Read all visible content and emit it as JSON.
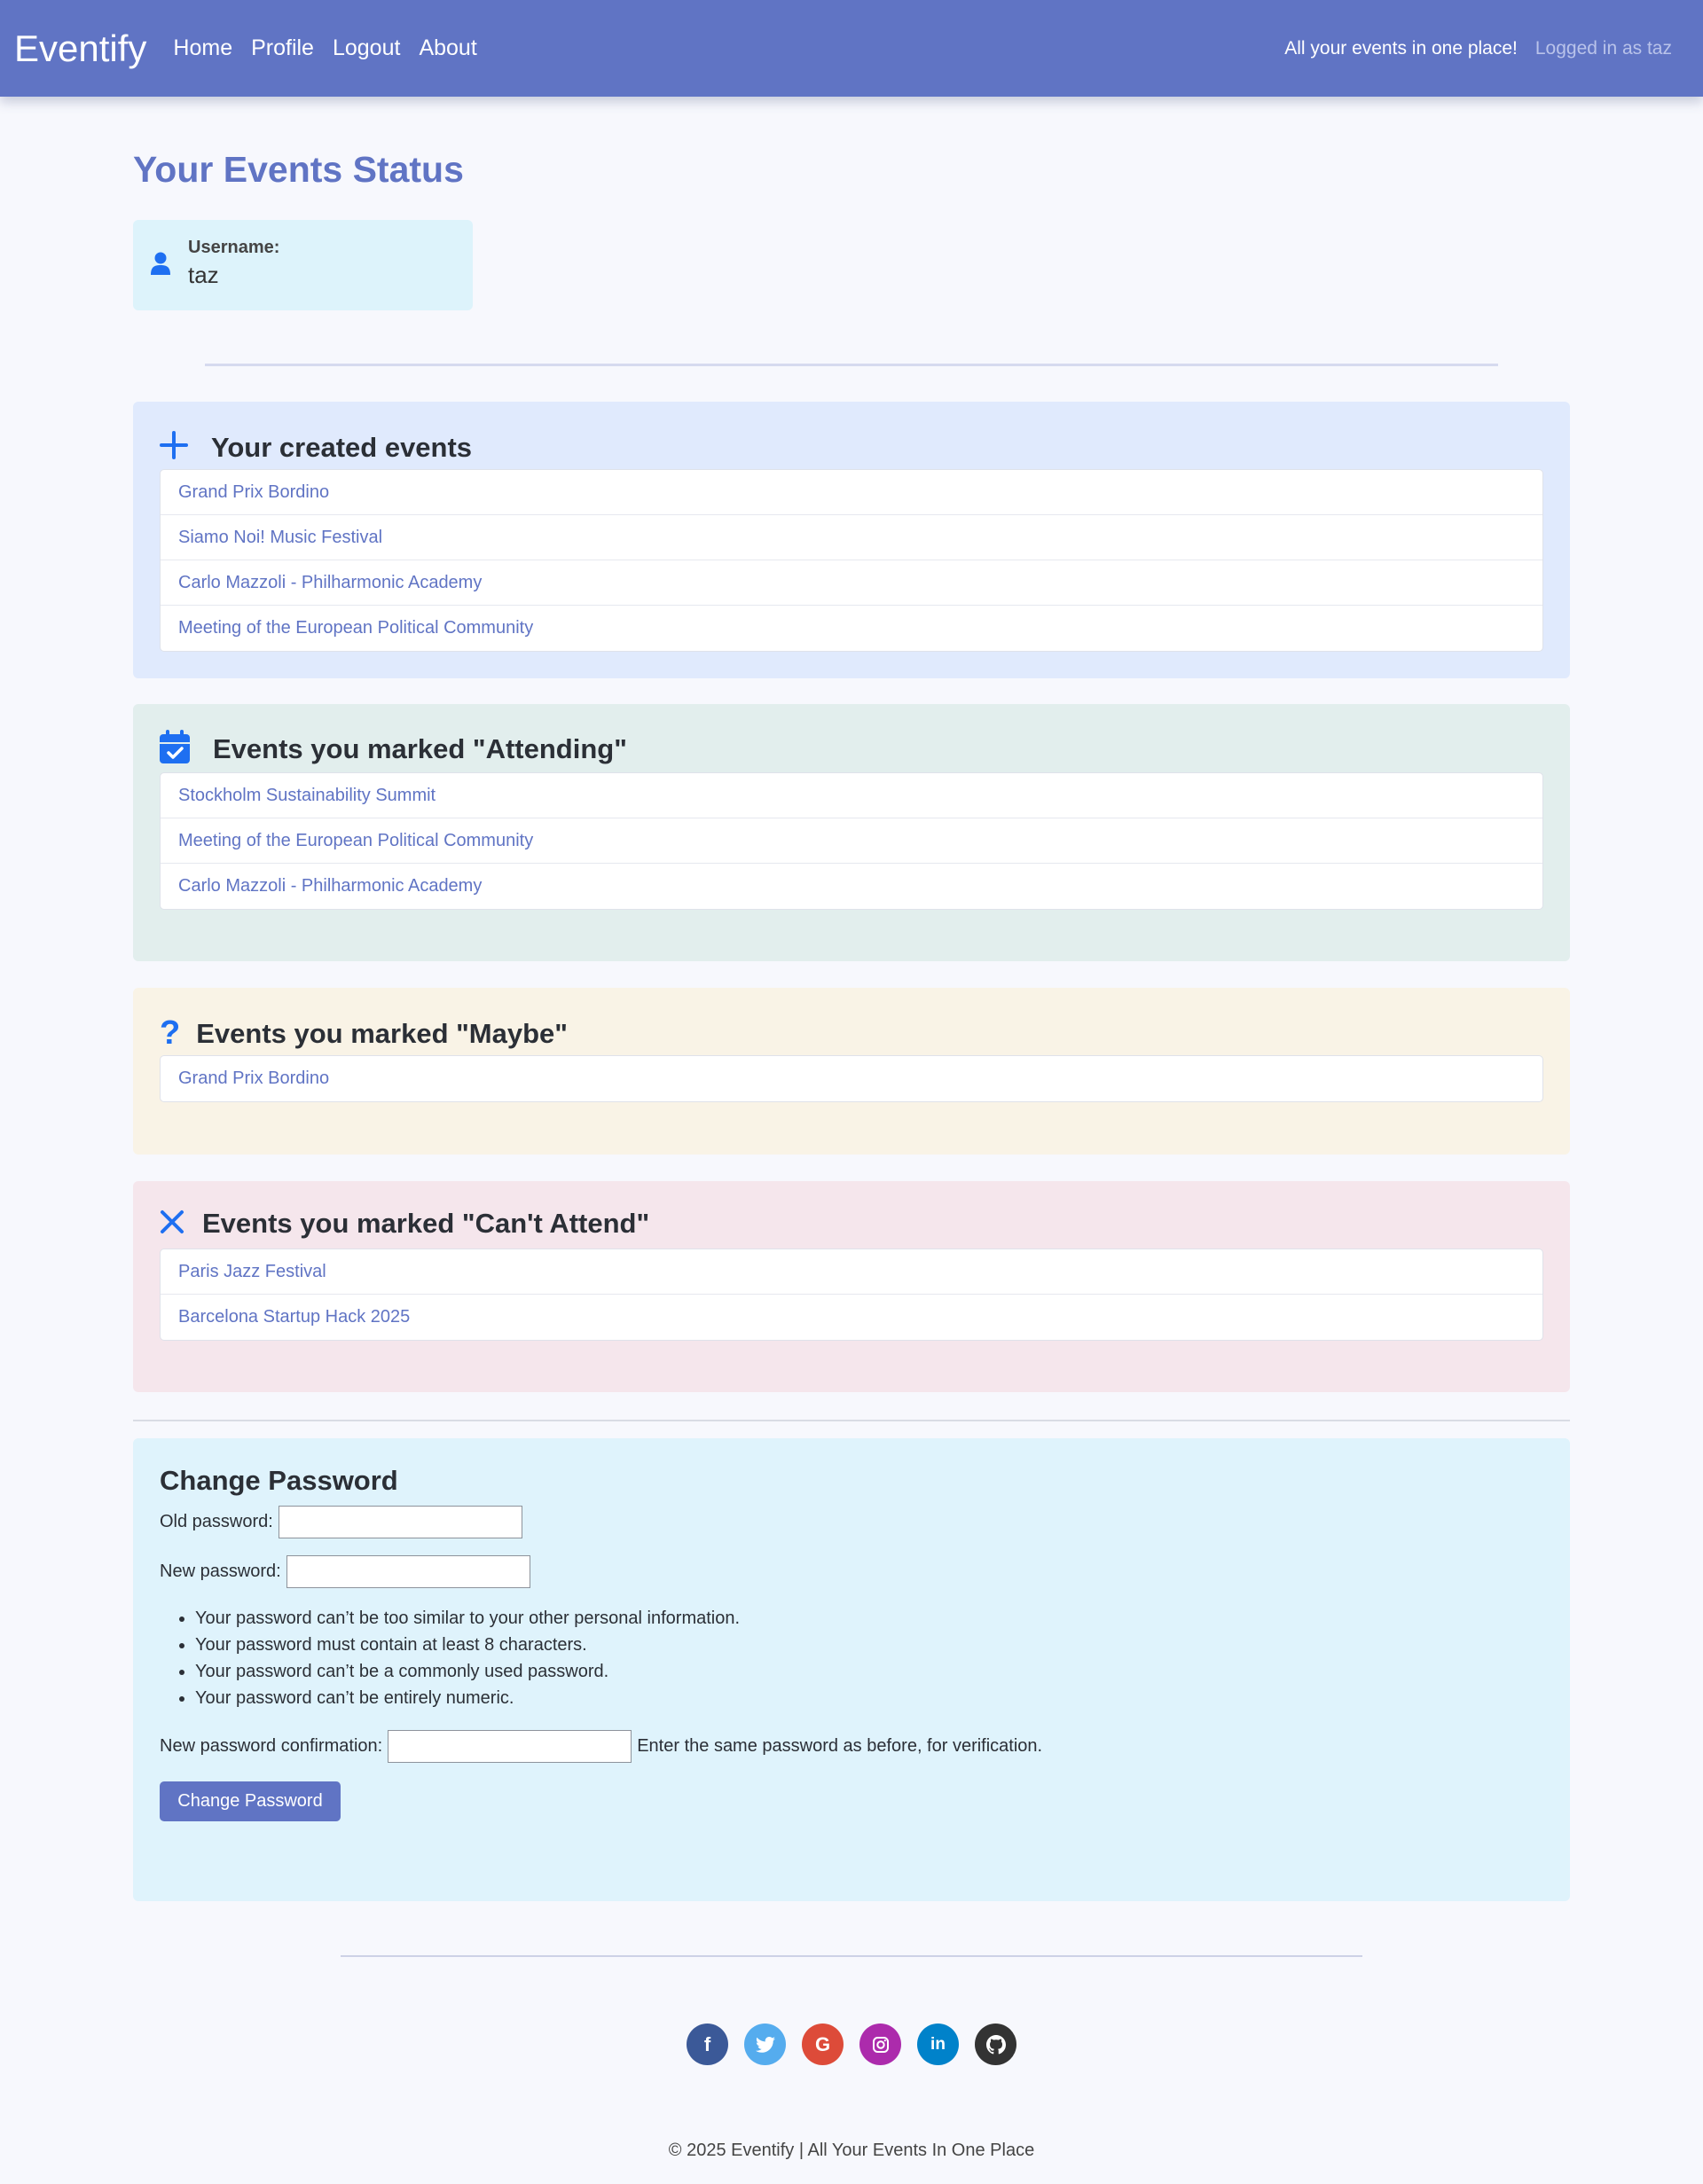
{
  "navbar": {
    "brand": "Eventify",
    "links": [
      "Home",
      "Profile",
      "Logout",
      "About"
    ],
    "tagline": "All your events in one place!",
    "logged_in": "Logged in as taz",
    "bg_color": "#6074c4"
  },
  "page_title": "Your Events Status",
  "user": {
    "label": "Username:",
    "value": "taz",
    "icon": "user-icon"
  },
  "sections": {
    "created": {
      "title": "Your created events",
      "icon": "plus-icon",
      "items": [
        "Grand Prix Bordino",
        "Siamo Noi! Music Festival",
        "Carlo Mazzoli - Philharmonic Academy",
        "Meeting of the European Political Community"
      ]
    },
    "attending": {
      "title": "Events you marked \"Attending\"",
      "icon": "calendar-check-icon",
      "items": [
        "Stockholm Sustainability Summit",
        "Meeting of the European Political Community",
        "Carlo Mazzoli - Philharmonic Academy"
      ]
    },
    "maybe": {
      "title": "Events you marked \"Maybe\"",
      "icon": "question-icon",
      "items": [
        "Grand Prix Bordino"
      ]
    },
    "cant": {
      "title": "Events you marked \"Can't Attend\"",
      "icon": "x-icon",
      "items": [
        "Paris Jazz Festival",
        "Barcelona Startup Hack 2025"
      ]
    }
  },
  "password": {
    "title": "Change Password",
    "old_label": "Old password:",
    "new_label": "New password:",
    "rules": [
      "Your password can’t be too similar to your other personal information.",
      "Your password must contain at least 8 characters.",
      "Your password can’t be a commonly used password.",
      "Your password can’t be entirely numeric."
    ],
    "confirm_label": "New password confirmation:",
    "confirm_help": "Enter the same password as before, for verification.",
    "button": "Change Password"
  },
  "socials": [
    {
      "name": "facebook-icon",
      "glyph": "f",
      "color": "#3b5998"
    },
    {
      "name": "twitter-icon",
      "glyph": "t",
      "color": "#55acee"
    },
    {
      "name": "google-icon",
      "glyph": "G",
      "color": "#dd4b39"
    },
    {
      "name": "instagram-icon",
      "glyph": "◎",
      "color": "#ac2bac"
    },
    {
      "name": "linkedin-icon",
      "glyph": "in",
      "color": "#0082ca"
    },
    {
      "name": "github-icon",
      "glyph": "●",
      "color": "#333333"
    }
  ],
  "footer": "© 2025 Eventify | All Your Events In One Place"
}
